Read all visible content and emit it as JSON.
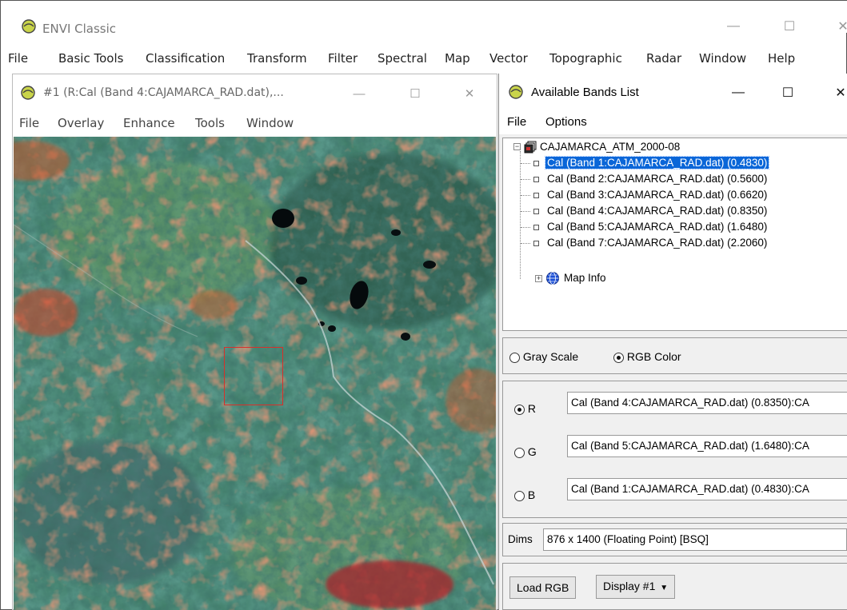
{
  "app": {
    "title": "ENVI Classic",
    "menu": [
      "File",
      "Basic Tools",
      "Classification",
      "Transform",
      "Filter",
      "Spectral",
      "Map",
      "Vector",
      "Topographic",
      "Radar",
      "Window",
      "Help"
    ]
  },
  "image_window": {
    "title": "#1 (R:Cal (Band 4:CAJAMARCA_RAD.dat),...",
    "menu": [
      "File",
      "Overlay",
      "Enhance",
      "Tools",
      "Window"
    ]
  },
  "bands_window": {
    "title": "Available Bands List",
    "menu": [
      "File",
      "Options"
    ],
    "tree": {
      "root": "CAJAMARCA_ATM_2000-08",
      "bands": [
        "Cal (Band 1:CAJAMARCA_RAD.dat) (0.4830)",
        "Cal (Band 2:CAJAMARCA_RAD.dat) (0.5600)",
        "Cal (Band 3:CAJAMARCA_RAD.dat) (0.6620)",
        "Cal (Band 4:CAJAMARCA_RAD.dat) (0.8350)",
        "Cal (Band 5:CAJAMARCA_RAD.dat) (1.6480)",
        "Cal (Band 7:CAJAMARCA_RAD.dat) (2.2060)"
      ],
      "selected_index": 0,
      "map_info": "Map Info"
    },
    "mode": {
      "gray_label": "Gray Scale",
      "rgb_label": "RGB Color",
      "selected": "rgb"
    },
    "channels": {
      "r_label": "R",
      "g_label": "G",
      "b_label": "B",
      "r_value": "Cal (Band 4:CAJAMARCA_RAD.dat) (0.8350):CA",
      "g_value": "Cal (Band 5:CAJAMARCA_RAD.dat) (1.6480):CA",
      "b_value": "Cal (Band 1:CAJAMARCA_RAD.dat) (0.4830):CA",
      "selected": "r"
    },
    "dims_label": "Dims",
    "dims_value": "876 x 1400 (Floating Point) [BSQ]",
    "load_button": "Load RGB",
    "display_button": "Display #1"
  },
  "colors": {
    "selection": "#0a66d8",
    "roi_box": "#d8302a"
  }
}
